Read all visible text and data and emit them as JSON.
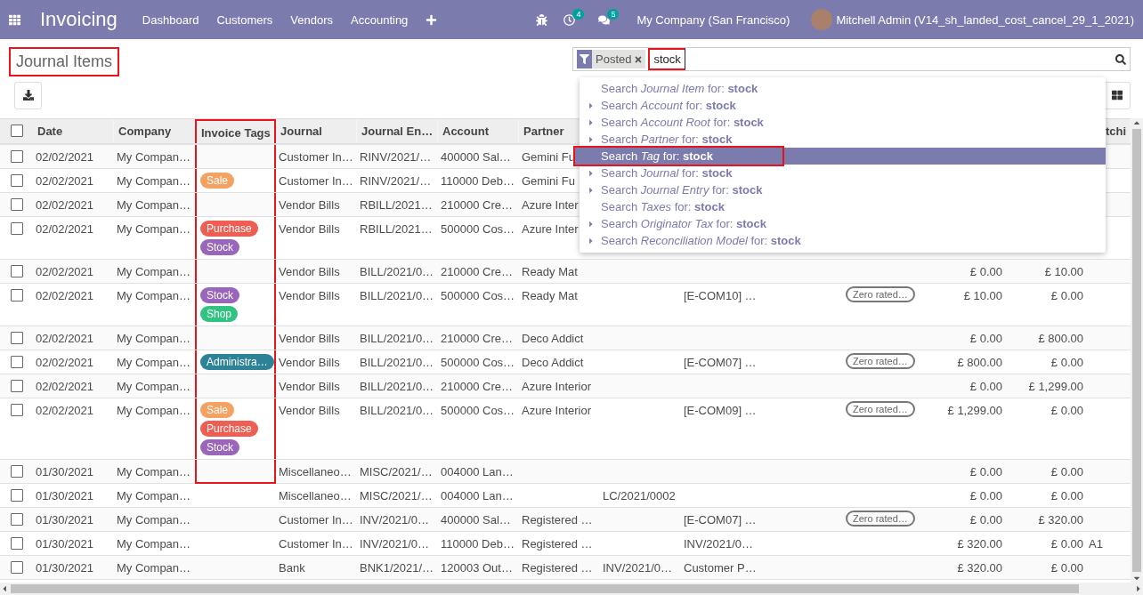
{
  "navbar": {
    "app": "Invoicing",
    "menu": [
      "Dashboard",
      "Customers",
      "Vendors",
      "Accounting"
    ],
    "activity_count": "4",
    "message_count": "5",
    "company": "My Company (San Francisco)",
    "user": "Mitchell Admin (V14_sh_landed_cost_cancel_29_1_2021)"
  },
  "page": {
    "title": "Journal Items",
    "title_annotated": true
  },
  "search": {
    "facet": "Posted",
    "value": "stock",
    "value_annotated": true
  },
  "suggestions": [
    {
      "text": "Search *Journal Item* for: **stock**",
      "expandable": false,
      "selected": false,
      "annotated": false
    },
    {
      "text": "Search *Account* for: **stock**",
      "expandable": true,
      "selected": false,
      "annotated": false
    },
    {
      "text": "Search *Account Root* for: **stock**",
      "expandable": true,
      "selected": false,
      "annotated": false
    },
    {
      "text": "Search *Partner* for: **stock**",
      "expandable": true,
      "selected": false,
      "annotated": false
    },
    {
      "text": "Search *Tag* for: **stock**",
      "expandable": false,
      "selected": true,
      "annotated": true
    },
    {
      "text": "Search *Journal* for: **stock**",
      "expandable": true,
      "selected": false,
      "annotated": false
    },
    {
      "text": "Search *Journal Entry* for: **stock**",
      "expandable": true,
      "selected": false,
      "annotated": false
    },
    {
      "text": "Search *Taxes* for: **stock**",
      "expandable": false,
      "selected": false,
      "annotated": false
    },
    {
      "text": "Search *Originator Tax* for: **stock**",
      "expandable": true,
      "selected": false,
      "annotated": false
    },
    {
      "text": "Search *Reconciliation Model* for: **stock**",
      "expandable": true,
      "selected": false,
      "annotated": false
    }
  ],
  "table": {
    "columns": [
      {
        "label": "Date",
        "annotated": false
      },
      {
        "label": "Company",
        "annotated": false
      },
      {
        "label": "Invoice Tags",
        "annotated": true
      },
      {
        "label": "Journal",
        "annotated": false
      },
      {
        "label": "Journal En…",
        "annotated": false
      },
      {
        "label": "Account",
        "annotated": false
      },
      {
        "label": "Partner",
        "annotated": false
      }
    ],
    "column_15_header": "tchi",
    "all_checked": false,
    "rows": [
      {
        "checked": false,
        "tag_frame": true,
        "date": "02/02/2021",
        "company": "My Compan…",
        "tags": [],
        "journal": "Customer In…",
        "entry": "RINV/2021/…",
        "account": "400000 Sal…",
        "partner": "Gemini Fu"
      },
      {
        "checked": false,
        "tag_frame": true,
        "date": "02/02/2021",
        "company": "My Compan…",
        "tags": [
          {
            "label": "Sale",
            "color": "#f4a261"
          }
        ],
        "journal": "Customer In…",
        "entry": "RINV/2021/…",
        "account": "110000 Deb…",
        "partner": "Gemini Fu"
      },
      {
        "checked": false,
        "tag_frame": true,
        "date": "02/02/2021",
        "company": "My Compan…",
        "tags": [],
        "journal": "Vendor Bills",
        "entry": "RBILL/2021…",
        "account": "210000 Cre…",
        "partner": "Azure Inter"
      },
      {
        "checked": false,
        "tag_frame": true,
        "date": "02/02/2021",
        "company": "My Compan…",
        "tags": [
          {
            "label": "Purchase",
            "color": "#ef5e52"
          },
          {
            "label": "Stock",
            "color": "#9a66bc"
          }
        ],
        "journal": "Vendor Bills",
        "entry": "RBILL/2021…",
        "account": "500000 Cos…",
        "partner": "Azure Inter"
      },
      {
        "checked": false,
        "tag_frame": true,
        "date": "02/02/2021",
        "company": "My Compan…",
        "tags": [],
        "journal": "Vendor Bills",
        "entry": "BILL/2021/0…",
        "account": "210000 Cre…",
        "partner": "Ready Mat",
        "debit": "£ 0.00",
        "credit": "£ 10.00"
      },
      {
        "checked": false,
        "tag_frame": true,
        "date": "02/02/2021",
        "company": "My Compan…",
        "tags": [
          {
            "label": "Stock",
            "color": "#9a66bc"
          },
          {
            "label": "Shop",
            "color": "#30c381"
          }
        ],
        "journal": "Vendor Bills",
        "entry": "BILL/2021/0…",
        "account": "500000 Cos…",
        "partner": "Ready Mat",
        "column_10": "[E-COM10] …",
        "tax": "Zero rated…",
        "debit": "£ 10.00",
        "credit": "£ 0.00"
      },
      {
        "checked": false,
        "tag_frame": true,
        "date": "02/02/2021",
        "company": "My Compan…",
        "tags": [],
        "journal": "Vendor Bills",
        "entry": "BILL/2021/0…",
        "account": "210000 Cre…",
        "partner": "Deco Addict",
        "debit": "£ 0.00",
        "credit": "£ 800.00"
      },
      {
        "checked": false,
        "tag_frame": true,
        "date": "02/02/2021",
        "company": "My Compan…",
        "tags": [
          {
            "label": "Administra…",
            "color": "#2c8397"
          }
        ],
        "journal": "Vendor Bills",
        "entry": "BILL/2021/0…",
        "account": "500000 Cos…",
        "partner": "Deco Addict",
        "column_10": "[E-COM07] …",
        "tax": "Zero rated…",
        "debit": "£ 800.00",
        "credit": "£ 0.00"
      },
      {
        "checked": false,
        "tag_frame": true,
        "date": "02/02/2021",
        "company": "My Compan…",
        "tags": [],
        "journal": "Vendor Bills",
        "entry": "BILL/2021/0…",
        "account": "210000 Cre…",
        "partner": "Azure Interior",
        "debit": "£ 0.00",
        "credit": "£ 1,299.00"
      },
      {
        "checked": false,
        "tag_frame": true,
        "date": "02/02/2021",
        "company": "My Compan…",
        "tags": [
          {
            "label": "Sale",
            "color": "#f4a261"
          },
          {
            "label": "Purchase",
            "color": "#ef5e52"
          },
          {
            "label": "Stock",
            "color": "#9a66bc"
          }
        ],
        "journal": "Vendor Bills",
        "entry": "BILL/2021/0…",
        "account": "500000 Cos…",
        "partner": "Azure Interior",
        "column_10": "[E-COM09] …",
        "tax": "Zero rated…",
        "debit": "£ 1,299.00",
        "credit": "£ 0.00"
      },
      {
        "checked": false,
        "tag_frame": true,
        "date": "01/30/2021",
        "company": "My Compan…",
        "tags": [],
        "journal": "Miscellaneo…",
        "entry": "MISC/2021/…",
        "account": "004000 Lan…",
        "debit": "£ 0.00",
        "credit": "£ 0.00"
      },
      {
        "checked": false,
        "tag_frame": false,
        "date": "01/30/2021",
        "company": "My Compan…",
        "tags": [],
        "journal": "Miscellaneo…",
        "entry": "MISC/2021/…",
        "account": "004000 Lan…",
        "column_9": "LC/2021/0002",
        "debit": "£ 0.00",
        "credit": "£ 0.00"
      },
      {
        "checked": false,
        "tag_frame": false,
        "date": "01/30/2021",
        "company": "My Compan…",
        "tags": [],
        "journal": "Customer In…",
        "entry": "INV/2021/0…",
        "account": "400000 Sal…",
        "partner": "Registered …",
        "column_10": "[E-COM07] …",
        "tax": "Zero rated…",
        "debit": "£ 0.00",
        "credit": "£ 320.00"
      },
      {
        "checked": false,
        "tag_frame": false,
        "date": "01/30/2021",
        "company": "My Compan…",
        "tags": [],
        "journal": "Customer In…",
        "entry": "INV/2021/0…",
        "account": "110000 Deb…",
        "partner": "Registered …",
        "column_10": "INV/2021/0…",
        "debit": "£ 320.00",
        "credit": "£ 0.00",
        "column_15": "A1"
      },
      {
        "checked": false,
        "tag_frame": false,
        "date": "01/30/2021",
        "company": "My Compan…",
        "tags": [],
        "journal": "Bank",
        "entry": "BNK1/2021/…",
        "account": "120003 Out…",
        "partner": "Registered …",
        "column_9": "INV/2021/0…",
        "column_10": "Customer P…",
        "debit": "£ 320.00",
        "credit": "£ 0.00"
      }
    ]
  }
}
